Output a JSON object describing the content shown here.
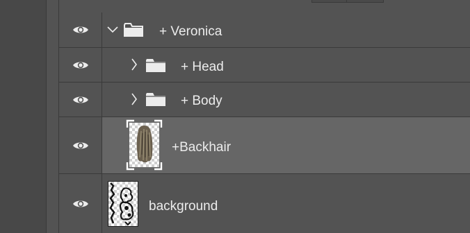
{
  "layers": [
    {
      "name": "+ Veronica",
      "type": "group",
      "expanded": true,
      "icon": "folder-icon",
      "toggle_icon": "chevron-down-icon"
    },
    {
      "name": "+ Head",
      "type": "group",
      "expanded": false,
      "icon": "folder-icon",
      "toggle_icon": "chevron-right-icon"
    },
    {
      "name": "+ Body",
      "type": "group",
      "expanded": false,
      "icon": "folder-icon",
      "toggle_icon": "chevron-right-icon"
    },
    {
      "name": "+Backhair",
      "type": "layer",
      "selected": true,
      "icon": "layer-thumbnail-icon"
    },
    {
      "name": "background",
      "type": "layer",
      "icon": "layer-thumbnail-icon"
    }
  ],
  "visibility_icon": "eye-icon",
  "colors": {
    "panel_bg": "#535353",
    "selected_bg": "#666666",
    "divider": "#3a3a3a",
    "text": "#ececec"
  }
}
